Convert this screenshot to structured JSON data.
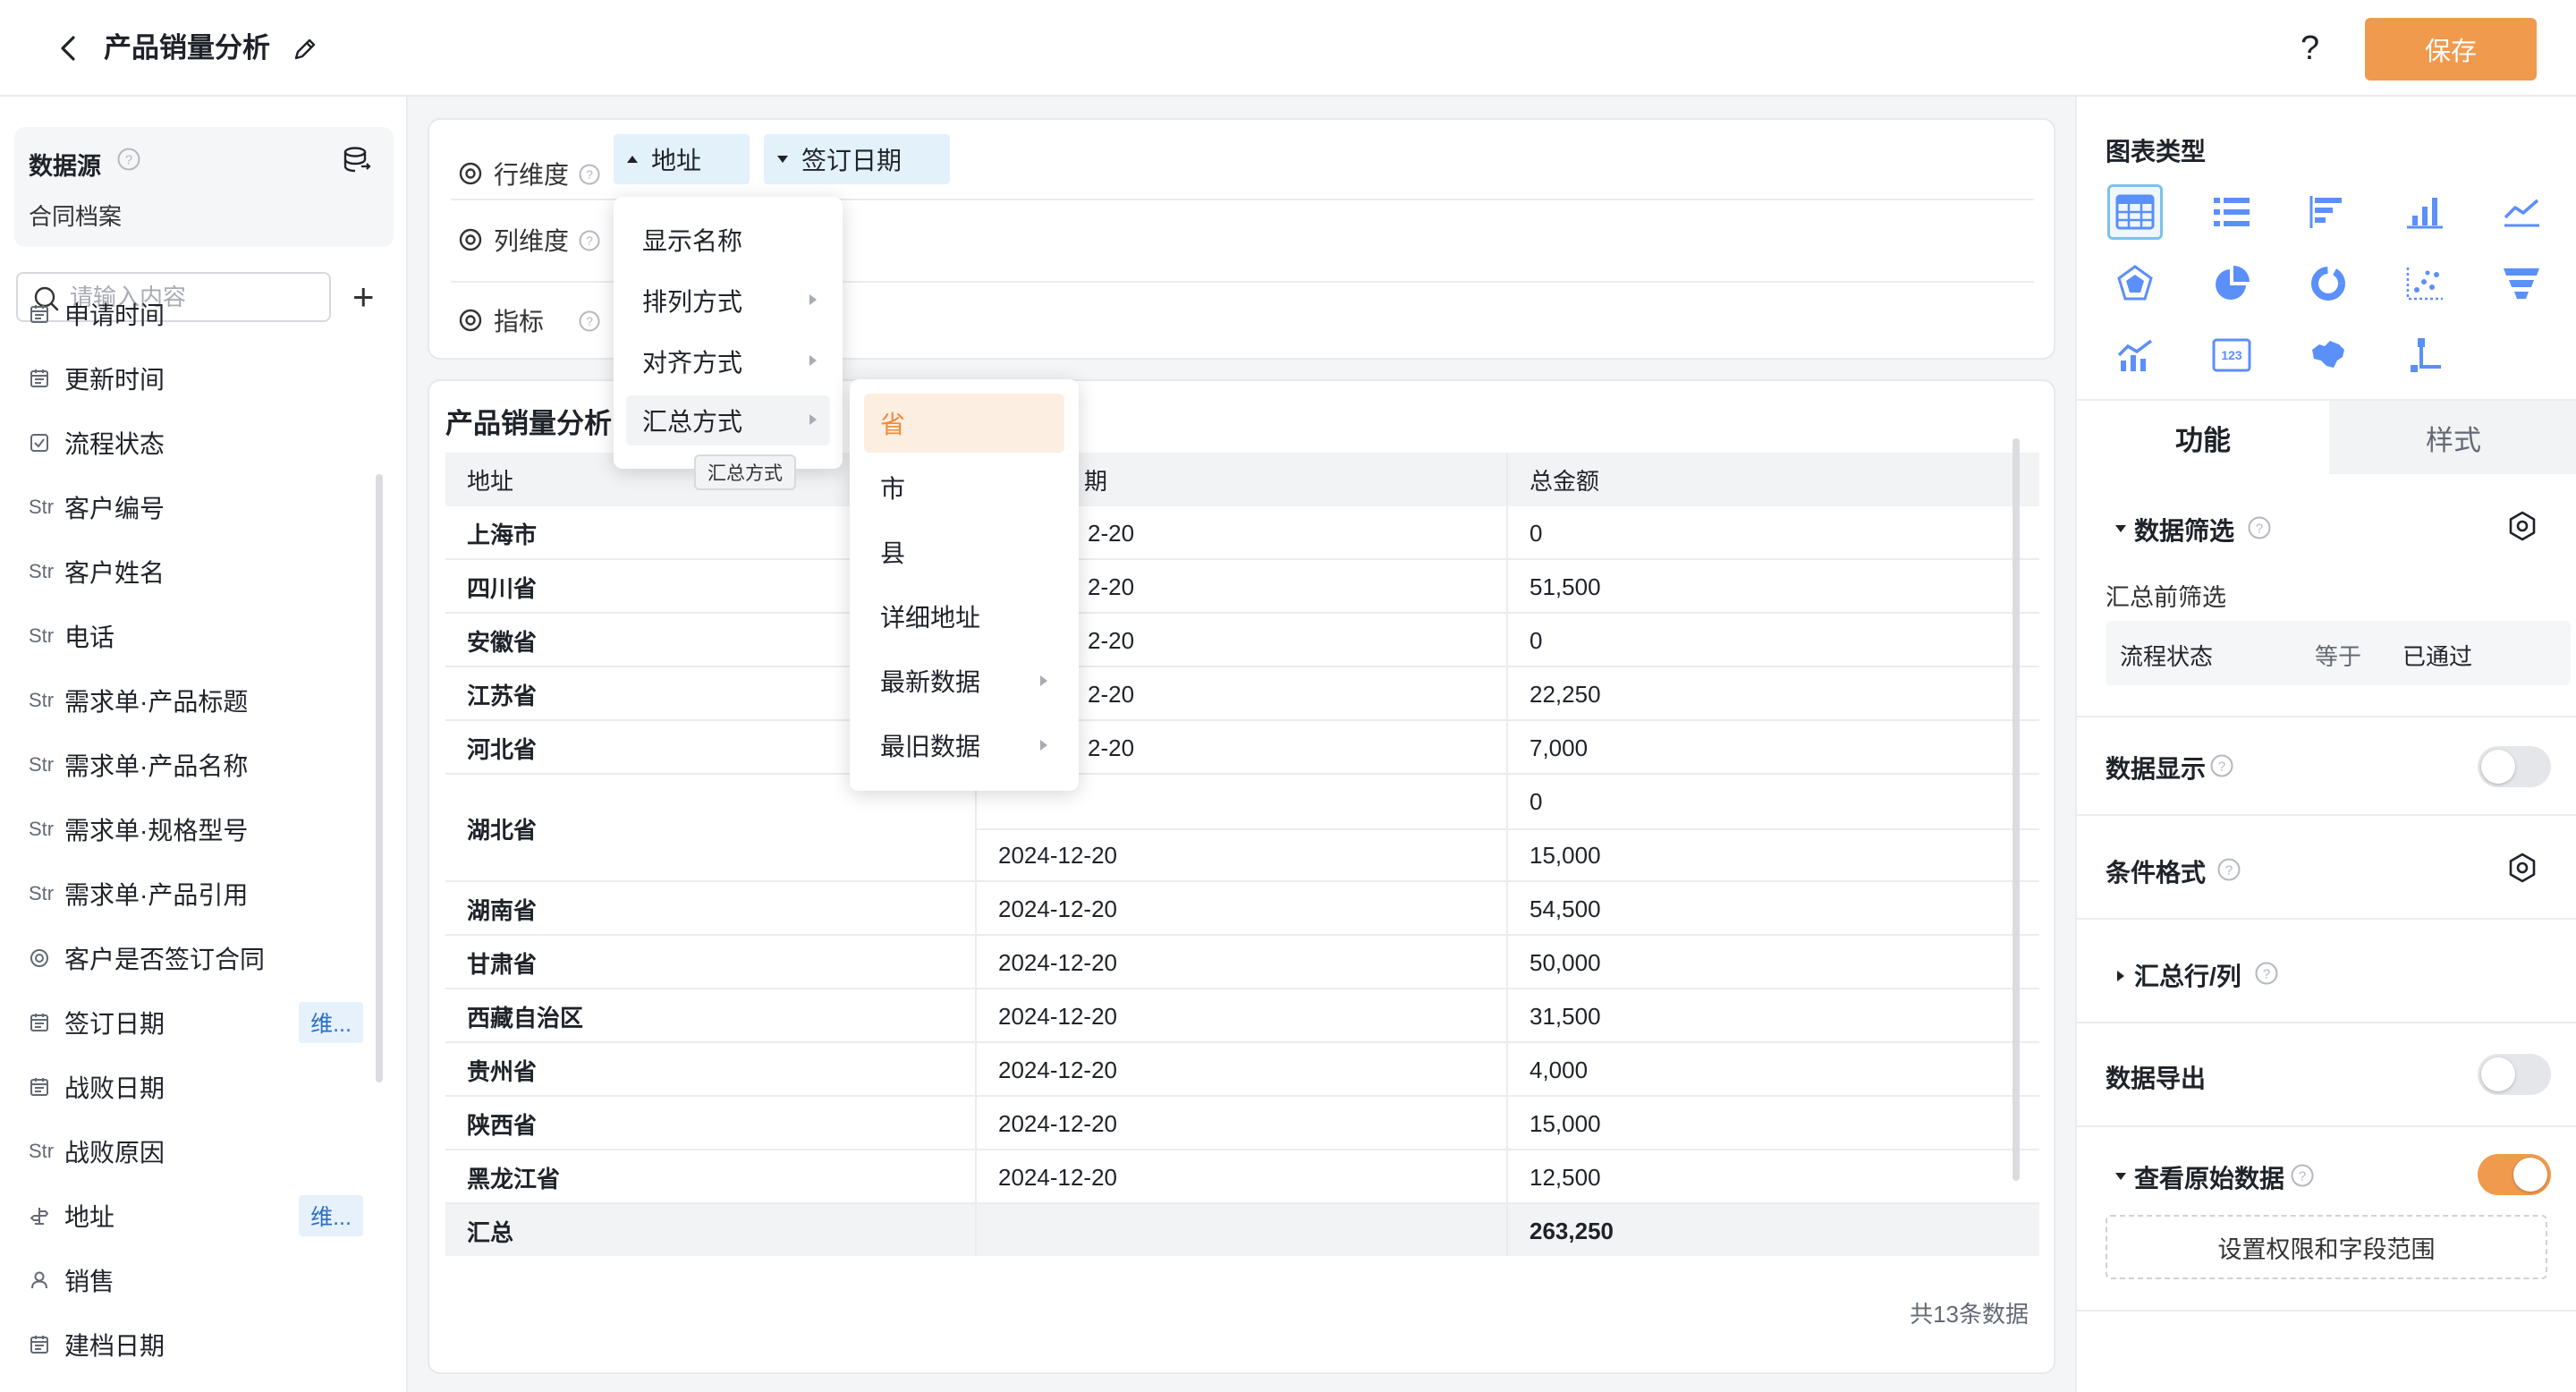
{
  "header": {
    "title": "产品销量分析",
    "help": "?",
    "save_label": "保存"
  },
  "left": {
    "datasource_title": "数据源",
    "datasource_name": "合同档案",
    "search_placeholder": "请输入内容",
    "add": "+",
    "fields": [
      {
        "type": "date",
        "name": "申请时间",
        "tag": ""
      },
      {
        "type": "date",
        "name": "更新时间",
        "tag": ""
      },
      {
        "type": "check",
        "name": "流程状态",
        "tag": ""
      },
      {
        "type": "Str",
        "name": "客户编号",
        "tag": ""
      },
      {
        "type": "Str",
        "name": "客户姓名",
        "tag": ""
      },
      {
        "type": "Str",
        "name": "电话",
        "tag": ""
      },
      {
        "type": "Str",
        "name": "需求单·产品标题",
        "tag": ""
      },
      {
        "type": "Str",
        "name": "需求单·产品名称",
        "tag": ""
      },
      {
        "type": "Str",
        "name": "需求单·规格型号",
        "tag": ""
      },
      {
        "type": "Str",
        "name": "需求单·产品引用",
        "tag": ""
      },
      {
        "type": "radio",
        "name": "客户是否签订合同",
        "tag": ""
      },
      {
        "type": "date",
        "name": "签订日期",
        "tag": "维..."
      },
      {
        "type": "date",
        "name": "战败日期",
        "tag": ""
      },
      {
        "type": "Str",
        "name": "战败原因",
        "tag": ""
      },
      {
        "type": "address",
        "name": "地址",
        "tag": "维..."
      },
      {
        "type": "user",
        "name": "销售",
        "tag": ""
      },
      {
        "type": "date",
        "name": "建档日期",
        "tag": ""
      }
    ]
  },
  "config": {
    "row_dim_label": "行维度",
    "col_dim_label": "列维度",
    "metric_label": "指标",
    "row_chips": [
      "地址",
      "签订日期"
    ]
  },
  "menu": {
    "items": [
      "显示名称",
      "排列方式",
      "对齐方式",
      "汇总方式"
    ],
    "tooltip": "汇总方式",
    "submenu": [
      "省",
      "市",
      "县",
      "详细地址",
      "最新数据",
      "最旧数据"
    ]
  },
  "table": {
    "title": "产品销量分析",
    "headers": [
      "地址",
      "期",
      "总金额"
    ],
    "rows": [
      {
        "province": "上海市",
        "date": "2-20",
        "amount": "0"
      },
      {
        "province": "四川省",
        "date": "2-20",
        "amount": "51,500"
      },
      {
        "province": "安徽省",
        "date": "2-20",
        "amount": "0"
      },
      {
        "province": "江苏省",
        "date": "2-20",
        "amount": "22,250"
      },
      {
        "province": "河北省",
        "date": "2-20",
        "amount": "7,000"
      },
      {
        "province": "湖北省",
        "date": "",
        "amount": "0"
      },
      {
        "province": "",
        "date": "2024-12-20",
        "amount": "15,000"
      },
      {
        "province": "湖南省",
        "date": "2024-12-20",
        "amount": "54,500"
      },
      {
        "province": "甘肃省",
        "date": "2024-12-20",
        "amount": "50,000"
      },
      {
        "province": "西藏自治区",
        "date": "2024-12-20",
        "amount": "31,500"
      },
      {
        "province": "贵州省",
        "date": "2024-12-20",
        "amount": "4,000"
      },
      {
        "province": "陕西省",
        "date": "2024-12-20",
        "amount": "15,000"
      },
      {
        "province": "黑龙江省",
        "date": "2024-12-20",
        "amount": "12,500"
      }
    ],
    "total_label": "汇总",
    "total_value": "263,250",
    "count_text": "共13条数据"
  },
  "right": {
    "chart_type_title": "图表类型",
    "chart_types": [
      "table-icon",
      "list-icon",
      "bar-horizontal-icon",
      "bar-vertical-icon",
      "line-icon",
      "radar-icon",
      "pie-icon",
      "donut-icon",
      "scatter-icon",
      "funnel-icon",
      "combo-icon",
      "number-card-icon",
      "map-icon",
      "tree-icon"
    ],
    "tab_function": "功能",
    "tab_style": "样式",
    "data_filter": "数据筛选",
    "pre_filter": "汇总前筛选",
    "filter": {
      "field": "流程状态",
      "op": "等于",
      "value": "已通过"
    },
    "data_display": "数据显示",
    "data_display_on": false,
    "cond_format": "条件格式",
    "summary_rowcol": "汇总行/列",
    "data_export": "数据导出",
    "data_export_on": false,
    "view_raw": "查看原始数据",
    "view_raw_on": true,
    "perm_button": "设置权限和字段范围"
  },
  "colors": {
    "accent": "#f09a4e",
    "chip_bg": "#e3f1fb",
    "tag_bg": "#e6f1fb",
    "icon_blue": "#5b8ff9"
  }
}
